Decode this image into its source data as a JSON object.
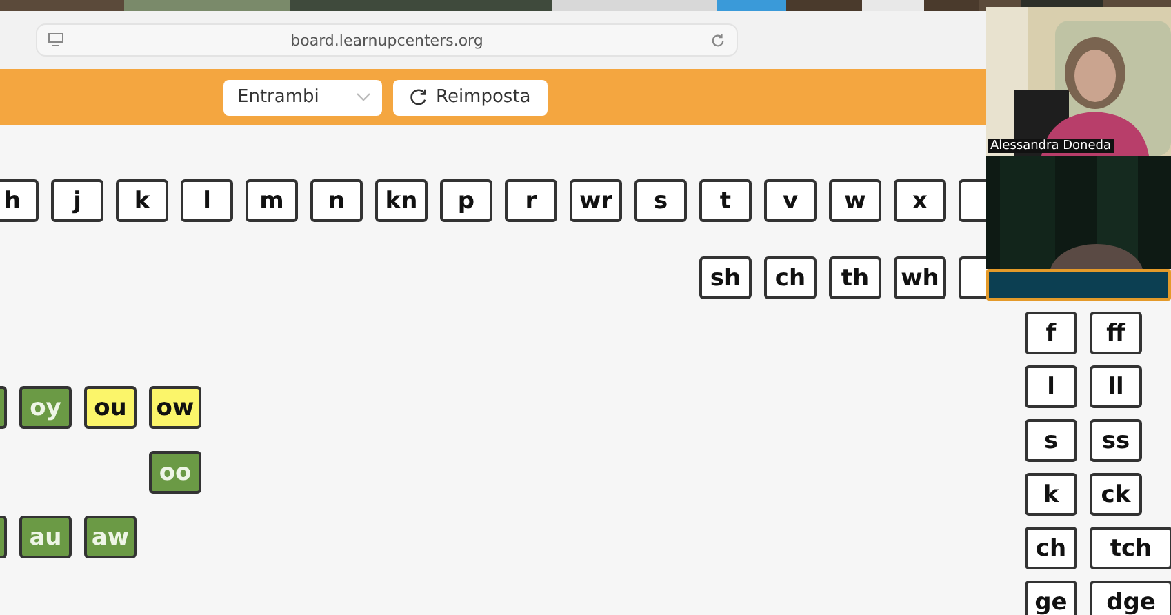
{
  "browser": {
    "url": "board.learnupcenters.org"
  },
  "toolbar": {
    "dropdown": {
      "value": "Entrambi"
    },
    "reset_button": {
      "label": "Reimposta"
    }
  },
  "board": {
    "rows": [
      {
        "tiles": [
          {
            "label": "h"
          },
          {
            "label": "j"
          },
          {
            "label": "k"
          },
          {
            "label": "l"
          },
          {
            "label": "m"
          },
          {
            "label": "n"
          },
          {
            "label": "kn"
          },
          {
            "label": "p"
          },
          {
            "label": "r"
          },
          {
            "label": "wr"
          },
          {
            "label": "s"
          },
          {
            "label": "t"
          },
          {
            "label": "v"
          },
          {
            "label": "w"
          },
          {
            "label": "x"
          },
          {
            "kind": "edge"
          }
        ]
      },
      {
        "tiles": [
          {
            "label": "sh"
          },
          {
            "label": "ch"
          },
          {
            "label": "th"
          },
          {
            "label": "wh"
          },
          {
            "kind": "edge"
          }
        ]
      },
      {
        "tiles": [
          {
            "kind": "edge",
            "color": "#6b9a45"
          },
          {
            "label": "oy",
            "color": "#6b9a45"
          },
          {
            "label": "ou",
            "color": "#fbf56a"
          },
          {
            "label": "ow",
            "color": "#fbf56a"
          }
        ]
      },
      {
        "tiles": [
          {
            "kind": "gap"
          },
          {
            "kind": "gap"
          },
          {
            "kind": "gap"
          },
          {
            "label": "oo",
            "color": "#6b9a45"
          }
        ]
      },
      {
        "tiles": [
          {
            "kind": "edge",
            "color": "#6b9a45"
          },
          {
            "label": "au",
            "color": "#6b9a45"
          },
          {
            "label": "aw",
            "color": "#6b9a45"
          }
        ]
      }
    ],
    "pairs": [
      [
        "f",
        "ff"
      ],
      [
        "l",
        "ll"
      ],
      [
        "s",
        "ss"
      ],
      [
        "k",
        "ck"
      ],
      [
        "ch",
        "tch"
      ],
      [
        "ge",
        "dge"
      ]
    ]
  },
  "video_call": {
    "participants": [
      {
        "name": "Alessandra Doneda",
        "kind": "camera"
      },
      {
        "kind": "dark"
      }
    ]
  }
}
